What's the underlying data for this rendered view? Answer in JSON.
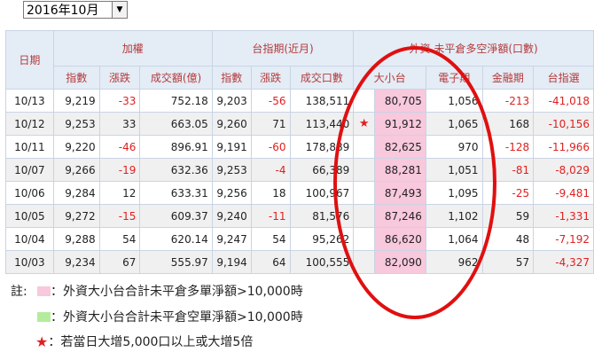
{
  "selector": {
    "value": "2016年10月"
  },
  "table": {
    "header": {
      "date": "日期",
      "group1": "加權",
      "group2": "台指期(近月)",
      "group3": "外資 未平倉多空淨額(口數)",
      "sub": [
        "指數",
        "漲跌",
        "成交額(億)",
        "指數",
        "漲跌",
        "成交口數",
        "大小台",
        "電子期",
        "金融期",
        "台指選"
      ]
    },
    "rows": [
      {
        "date": "10/13",
        "idx": "9,219",
        "chg": "-33",
        "amt": "752.18",
        "fidx": "9,203",
        "fchg": "-56",
        "vol": "138,511",
        "star": "",
        "big": "80,705",
        "elec": "1,056",
        "fin": "-213",
        "opt": "-41,018"
      },
      {
        "date": "10/12",
        "idx": "9,253",
        "chg": "33",
        "amt": "663.05",
        "fidx": "9,260",
        "fchg": "71",
        "vol": "113,440",
        "star": "★",
        "big": "91,912",
        "elec": "1,065",
        "fin": "168",
        "opt": "-10,156"
      },
      {
        "date": "10/11",
        "idx": "9,220",
        "chg": "-46",
        "amt": "896.91",
        "fidx": "9,191",
        "fchg": "-60",
        "vol": "178,889",
        "star": "",
        "big": "82,625",
        "elec": "970",
        "fin": "-128",
        "opt": "-11,966"
      },
      {
        "date": "10/07",
        "idx": "9,266",
        "chg": "-19",
        "amt": "632.36",
        "fidx": "9,253",
        "fchg": "-4",
        "vol": "66,389",
        "star": "",
        "big": "88,281",
        "elec": "1,051",
        "fin": "-81",
        "opt": "-8,029"
      },
      {
        "date": "10/06",
        "idx": "9,284",
        "chg": "12",
        "amt": "633.31",
        "fidx": "9,256",
        "fchg": "18",
        "vol": "100,967",
        "star": "",
        "big": "87,493",
        "elec": "1,095",
        "fin": "-25",
        "opt": "-9,481"
      },
      {
        "date": "10/05",
        "idx": "9,272",
        "chg": "-15",
        "amt": "609.37",
        "fidx": "9,240",
        "fchg": "-11",
        "vol": "81,576",
        "star": "",
        "big": "87,246",
        "elec": "1,102",
        "fin": "59",
        "opt": "-1,331"
      },
      {
        "date": "10/04",
        "idx": "9,288",
        "chg": "54",
        "amt": "620.14",
        "fidx": "9,247",
        "fchg": "54",
        "vol": "95,262",
        "star": "",
        "big": "86,620",
        "elec": "1,064",
        "fin": "48",
        "opt": "-7,192"
      },
      {
        "date": "10/03",
        "idx": "9,234",
        "chg": "67",
        "amt": "555.97",
        "fidx": "9,194",
        "fchg": "64",
        "vol": "100,555",
        "star": "",
        "big": "82,090",
        "elec": "962",
        "fin": "57",
        "opt": "-4,327"
      }
    ]
  },
  "notes": {
    "label": "註:",
    "items": [
      {
        "text": "：外資大小台合計未平倉多單淨額>10,000時",
        "color": "#f8c8dc"
      },
      {
        "text": "：外資大小台合計未平倉空單淨額>10,000時",
        "color": "#b4ec9c"
      },
      {
        "text": "：若當日大增5,000口以上或大增5倍",
        "glyph": "★"
      }
    ]
  },
  "colors": {
    "highlight": "#f8c8dc",
    "negative": "#e02020",
    "header_bg": "#e4ecf6",
    "header_text": "#b43a3a",
    "ellipse": "#e01010"
  }
}
